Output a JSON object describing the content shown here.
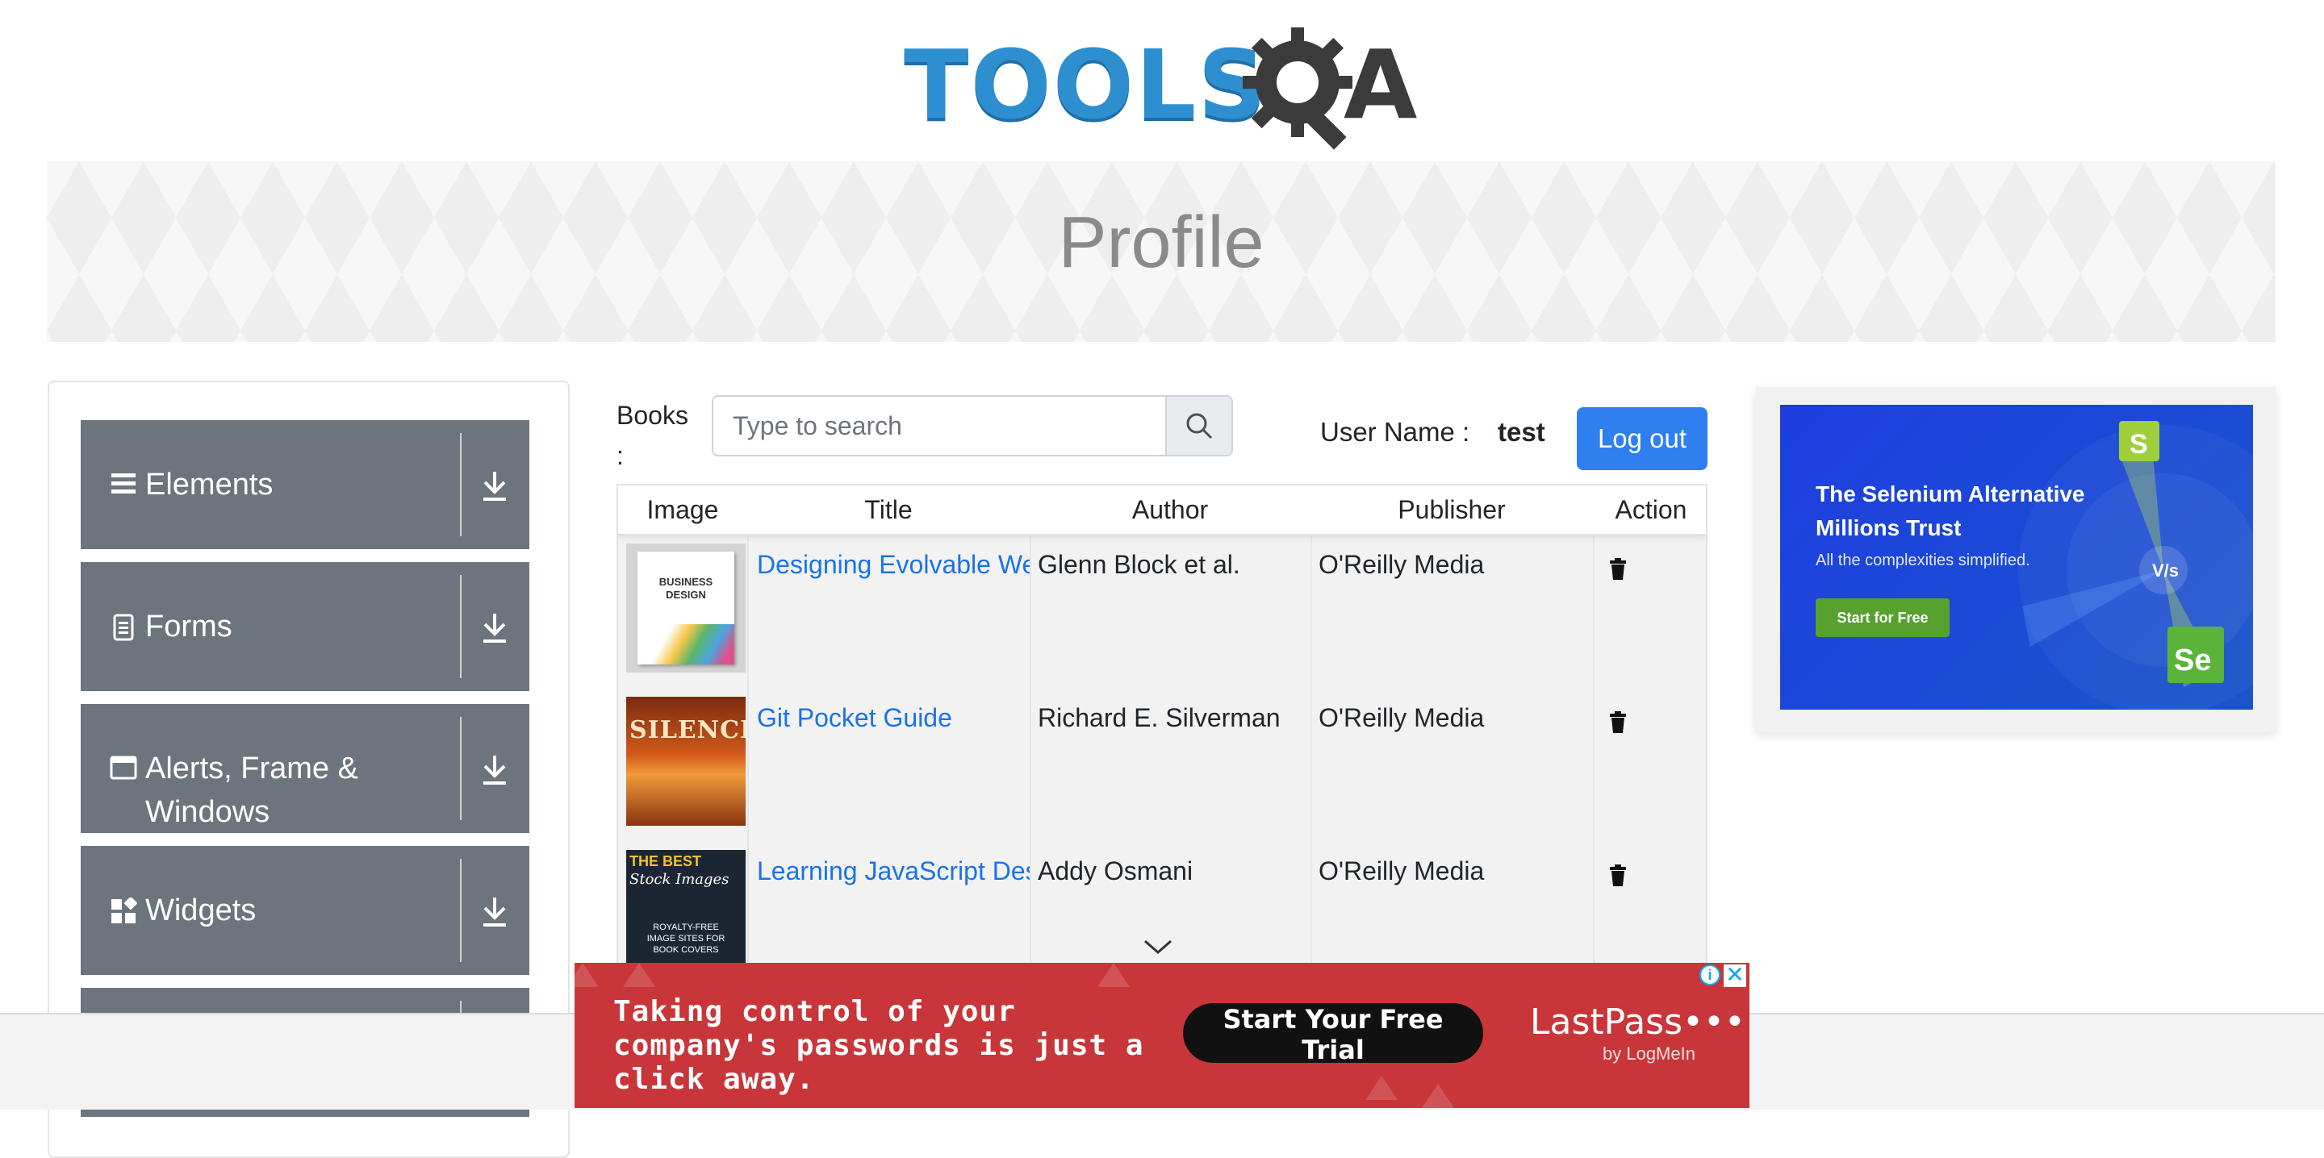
{
  "header": {
    "logo_text": "TOOLS",
    "logo_suffix": "A"
  },
  "banner": {
    "title": "Profile"
  },
  "sidebar": {
    "groups": [
      {
        "label": "Elements",
        "icon": "hamburger-icon"
      },
      {
        "label": "Forms",
        "icon": "document-icon"
      },
      {
        "label": "Alerts, Frame &",
        "label_line2": "Windows",
        "icon": "window-icon"
      },
      {
        "label": "Widgets",
        "icon": "widgets-icon"
      }
    ]
  },
  "toolbar": {
    "books_label": "Books",
    "books_colon": ":",
    "search_placeholder": "Type to search",
    "username_label": "User Name :",
    "username_value": "test",
    "logout_label": "Log out"
  },
  "table": {
    "headers": [
      "Image",
      "Title",
      "Author",
      "Publisher",
      "Action"
    ],
    "rows": [
      {
        "title": "Designing Evolvable Web APIs with ASP.NET",
        "author": "Glenn Block et al.",
        "publisher": "O'Reilly Media",
        "image_text": [
          "BUSINESS",
          "DESIGN"
        ]
      },
      {
        "title": "Git Pocket Guide",
        "author": "Richard E. Silverman",
        "publisher": "O'Reilly Media",
        "image_text": [
          "SILENCE"
        ]
      },
      {
        "title": "Learning JavaScript Design Patterns",
        "author": "Addy Osmani",
        "publisher": "O'Reilly Media",
        "image_text": [
          "THE BEST",
          "Stock Images",
          "ROYALTY-FREE",
          "IMAGE SITES FOR",
          "BOOK COVERS"
        ]
      }
    ]
  },
  "right_ad": {
    "headline": "The Selenium Alternative Millions Trust",
    "sub": "All the complexities simplified.",
    "button": "Start for Free",
    "badge_vs": "V/s",
    "badge_s": "S",
    "badge_se": "Se"
  },
  "bottom_ad": {
    "text": "Taking control of your company's passwords is just a click away.",
    "button": "Start Your Free Trial",
    "brand": "LastPass•••|",
    "brand_sub": "by LogMeIn",
    "info": "i",
    "close": "✕"
  },
  "colors": {
    "primary_button": "#2f7ff1",
    "menu_group_bg": "#6c757d",
    "link": "#1a73e8",
    "bottom_ad_bg": "#c8363a",
    "right_ad_bg": "#1e3ee0"
  }
}
